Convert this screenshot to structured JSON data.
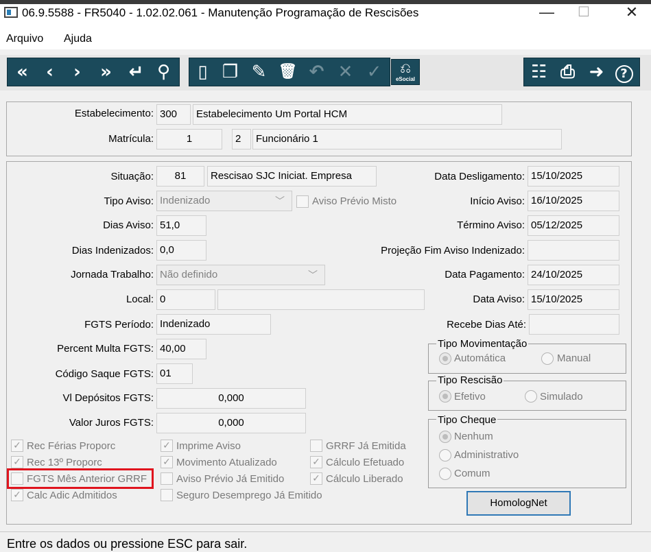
{
  "window": {
    "title": "06.9.5588 - FR5040 - 1.02.02.061 - Manutenção Programação de Rescisões",
    "minimize_glyph": "—",
    "maximize_glyph": "☐",
    "close_glyph": "✕"
  },
  "menu": [
    "Arquivo",
    "Ajuda"
  ],
  "toolbar": {
    "nav_icons": [
      "first-record-icon",
      "previous-record-icon",
      "next-record-icon",
      "last-record-icon",
      "goto-icon",
      "search-icon"
    ],
    "edit_icons": [
      "new-icon",
      "copy-icon",
      "edit-icon",
      "delete-icon",
      "undo-icon",
      "cancel-icon",
      "confirm-icon"
    ],
    "esocial_label": "eSocial",
    "right_icons": [
      "tree-icon",
      "print-icon",
      "exit-icon",
      "help-icon"
    ],
    "glyphs": {
      "first": "«",
      "prev": "‹",
      "next": "›",
      "last": "»",
      "goto": "↵",
      "search": "⚲",
      "new": "▯",
      "copy": "❐",
      "edit": "✎",
      "delete": "🗑",
      "undo": "↶",
      "cancel": "✕",
      "confirm": "✓",
      "tree": "☷",
      "print": "⎙",
      "exit": "➜",
      "help": "?"
    }
  },
  "header": {
    "estabelecimento_label": "Estabelecimento:",
    "estabelecimento_code": "300",
    "estabelecimento_name": "Estabelecimento Um Portal HCM",
    "matricula_label": "Matrícula:",
    "matricula_value": "1",
    "funcionario_code": "2",
    "funcionario_name": "Funcionário 1"
  },
  "form": {
    "situacao_label": "Situação:",
    "situacao_code": "81",
    "situacao_desc": "Rescisao SJC Iniciat. Empresa",
    "tipo_aviso_label": "Tipo Aviso:",
    "tipo_aviso_value": "Indenizado",
    "aviso_previo_misto_label": "Aviso Prévio Misto",
    "dias_aviso_label": "Dias Aviso:",
    "dias_aviso_value": "51,0",
    "dias_indenizados_label": "Dias Indenizados:",
    "dias_indenizados_value": "0,0",
    "jornada_label": "Jornada Trabalho:",
    "jornada_value": "Não definido",
    "local_label": "Local:",
    "local_code": "0",
    "local_desc": "",
    "fgts_periodo_label": "FGTS Período:",
    "fgts_periodo_value": "Indenizado",
    "percent_multa_label": "Percent Multa FGTS:",
    "percent_multa_value": "40,00",
    "codigo_saque_label": "Código Saque FGTS:",
    "codigo_saque_value": "01",
    "vl_depositos_label": "Vl Depósitos FGTS:",
    "vl_depositos_value": "0,000",
    "valor_juros_label": "Valor Juros FGTS:",
    "valor_juros_value": "0,000",
    "data_desligamento_label": "Data Desligamento:",
    "data_desligamento_value": "15/10/2025",
    "inicio_aviso_label": "Início Aviso:",
    "inicio_aviso_value": "16/10/2025",
    "termino_aviso_label": "Término Aviso:",
    "termino_aviso_value": "05/12/2025",
    "projecao_label": "Projeção Fim Aviso Indenizado:",
    "projecao_value": "",
    "data_pagamento_label": "Data Pagamento:",
    "data_pagamento_value": "24/10/2025",
    "data_aviso_label": "Data Aviso:",
    "data_aviso_value": "15/10/2025",
    "recebe_dias_label": "Recebe Dias Até:",
    "recebe_dias_value": ""
  },
  "groups": {
    "tipo_movimentacao": {
      "title": "Tipo Movimentação",
      "options": [
        "Automática",
        "Manual"
      ],
      "selected": "Automática"
    },
    "tipo_rescisao": {
      "title": "Tipo Rescisão",
      "options": [
        "Efetivo",
        "Simulado"
      ],
      "selected": "Efetivo"
    },
    "tipo_cheque": {
      "title": "Tipo Cheque",
      "options": [
        "Nenhum",
        "Administrativo",
        "Comum"
      ],
      "selected": "Nenhum"
    }
  },
  "checkboxes": {
    "col1": [
      {
        "label": "Rec Férias Proporc",
        "checked": true
      },
      {
        "label": "Rec 13º Proporc",
        "checked": true
      },
      {
        "label": "FGTS Mês Anterior GRRF",
        "checked": false
      },
      {
        "label": "Calc Adic Admitidos",
        "checked": true
      }
    ],
    "col2": [
      {
        "label": "Imprime Aviso",
        "checked": true
      },
      {
        "label": "Movimento Atualizado",
        "checked": true
      },
      {
        "label": "Aviso Prévio Já Emitido",
        "checked": false
      },
      {
        "label": "Seguro Desemprego Já Emitido",
        "checked": false
      }
    ],
    "col3": [
      {
        "label": "GRRF Já Emitida",
        "checked": false
      },
      {
        "label": "Cálculo Efetuado",
        "checked": true
      },
      {
        "label": "Cálculo Liberado",
        "checked": true
      }
    ]
  },
  "homolognet_label": "HomologNet",
  "status": "Entre os dados ou pressione ESC para sair.",
  "colors": {
    "toolbar": "#1b4a5b",
    "highlight": "#e0141e",
    "focus_border": "#2f78b6"
  }
}
